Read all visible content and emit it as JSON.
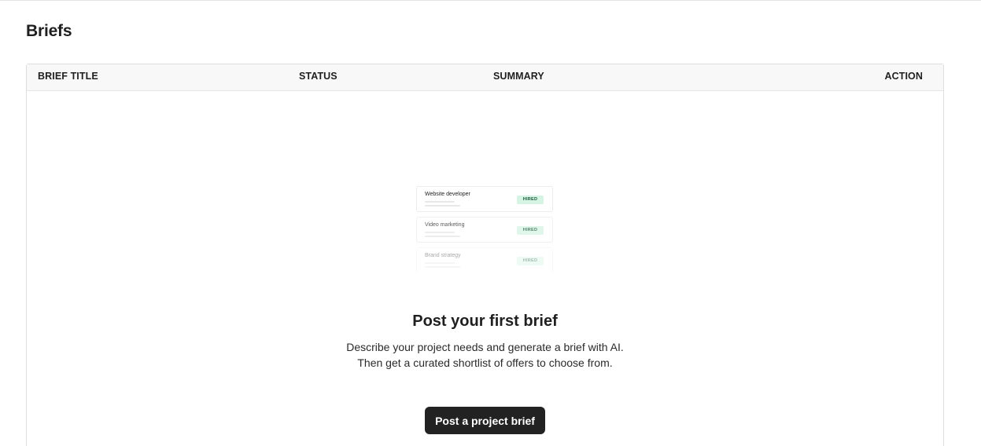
{
  "page": {
    "title": "Briefs"
  },
  "table": {
    "columns": [
      "BRIEF TITLE",
      "STATUS",
      "SUMMARY",
      "ACTION"
    ]
  },
  "illustration": {
    "cards": [
      {
        "title": "Website developer",
        "badge": "HIRED"
      },
      {
        "title": "Video marketing",
        "badge": "HIRED"
      },
      {
        "title": "Brand strategy",
        "badge": "HIRED"
      }
    ]
  },
  "empty_state": {
    "title": "Post your first brief",
    "description_line1": "Describe your project needs and generate a brief with AI.",
    "description_line2": "Then get a curated shortlist of offers to choose from.",
    "button_label": "Post a project brief"
  },
  "colors": {
    "button_bg": "#222222",
    "badge_bg": "#d6f4e4",
    "header_bg": "#f8f8f8"
  }
}
